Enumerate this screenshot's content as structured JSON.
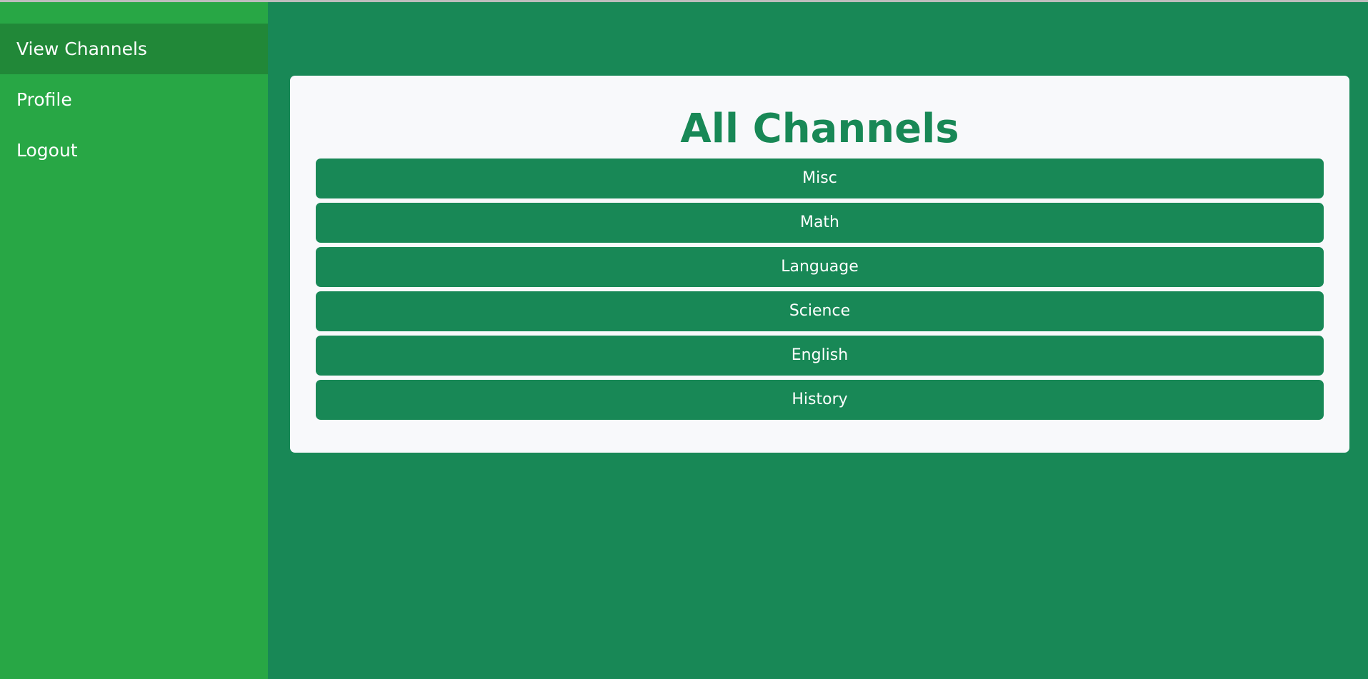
{
  "sidebar": {
    "items": [
      {
        "label": "View Channels",
        "active": true
      },
      {
        "label": "Profile",
        "active": false
      },
      {
        "label": "Logout",
        "active": false
      }
    ]
  },
  "main": {
    "title": "All Channels",
    "channels": [
      {
        "label": "Misc"
      },
      {
        "label": "Math"
      },
      {
        "label": "Language"
      },
      {
        "label": "Science"
      },
      {
        "label": "English"
      },
      {
        "label": "History"
      }
    ]
  },
  "colors": {
    "sidebar_bg": "#28a745",
    "sidebar_active": "#218838",
    "page_bg": "#188856",
    "card_bg": "#f8f9fb",
    "accent": "#188856"
  }
}
